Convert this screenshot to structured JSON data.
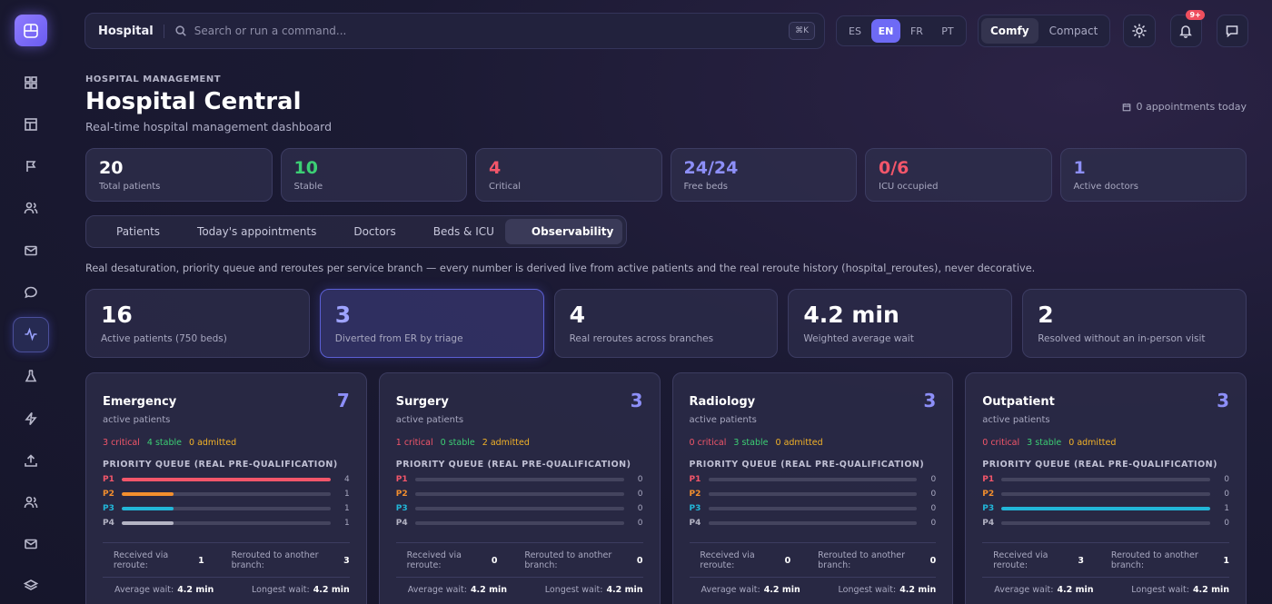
{
  "topbar": {
    "app_name": "Hospital",
    "search_placeholder": "Search or run a command...",
    "shortcut": "⌘K",
    "languages": [
      "ES",
      "EN",
      "FR",
      "PT"
    ],
    "active_language": "EN",
    "density": [
      "Comfy",
      "Compact"
    ],
    "active_density": "Comfy",
    "notification_badge": "9+"
  },
  "header": {
    "eyebrow": "HOSPITAL MANAGEMENT",
    "title": "Hospital Central",
    "subtitle": "Real-time hospital management dashboard",
    "appointments": "0 appointments today"
  },
  "kpis": [
    {
      "value": "20",
      "label": "Total patients",
      "color": "#ffffff"
    },
    {
      "value": "10",
      "label": "Stable",
      "color": "#3ccf74"
    },
    {
      "value": "4",
      "label": "Critical",
      "color": "#f3566a"
    },
    {
      "value": "24/24",
      "label": "Free beds",
      "color": "#8d8ff8"
    },
    {
      "value": "0/6",
      "label": "ICU occupied",
      "color": "#f3566a"
    },
    {
      "value": "1",
      "label": "Active doctors",
      "color": "#8d8ff8"
    }
  ],
  "tabs": [
    {
      "label": "Patients",
      "icon": "users-icon"
    },
    {
      "label": "Today's appointments",
      "icon": "calendar-icon"
    },
    {
      "label": "Doctors",
      "icon": "shield-icon"
    },
    {
      "label": "Beds & ICU",
      "icon": "grid-icon"
    },
    {
      "label": "Observability",
      "icon": "activity-icon",
      "active": true
    }
  ],
  "note": "Real desaturation, priority queue and reroutes per service branch — every number is derived live from active patients and the real reroute history (hospital_reroutes), never decorative.",
  "stats": [
    {
      "value": "16",
      "label": "Active patients (750 beds)"
    },
    {
      "value": "3",
      "label": "Diverted from ER by triage",
      "highlight": true
    },
    {
      "value": "4",
      "label": "Real reroutes across branches"
    },
    {
      "value": "4.2 min",
      "label": "Weighted average wait"
    },
    {
      "value": "2",
      "label": "Resolved without an in-person visit"
    }
  ],
  "labels": {
    "active_patients": "active patients",
    "priority_queue": "PRIORITY QUEUE (REAL PRE-QUALIFICATION)",
    "received": "Received via reroute:",
    "rerouted": "Rerouted to another branch:",
    "avg_wait": "Average wait:",
    "longest_wait": "Longest wait:",
    "critical": "critical",
    "stable": "stable",
    "admitted": "admitted"
  },
  "priority_colors": {
    "P1": "#f3566a",
    "P2": "#f38f2e",
    "P3": "#22b6d8",
    "P4": "#b4b4c4"
  },
  "branches": [
    {
      "name": "Emergency",
      "count": "7",
      "critical": "3",
      "stable": "4",
      "admitted": "0",
      "queue": [
        {
          "p": "P1",
          "n": 4
        },
        {
          "p": "P2",
          "n": 1
        },
        {
          "p": "P3",
          "n": 1
        },
        {
          "p": "P4",
          "n": 1
        }
      ],
      "received": "1",
      "rerouted": "3",
      "avg_wait": "4.2 min",
      "longest_wait": "4.2 min"
    },
    {
      "name": "Surgery",
      "count": "3",
      "critical": "1",
      "stable": "0",
      "admitted": "2",
      "queue": [
        {
          "p": "P1",
          "n": 0
        },
        {
          "p": "P2",
          "n": 0
        },
        {
          "p": "P3",
          "n": 0
        },
        {
          "p": "P4",
          "n": 0
        }
      ],
      "received": "0",
      "rerouted": "0",
      "avg_wait": "4.2 min",
      "longest_wait": "4.2 min"
    },
    {
      "name": "Radiology",
      "count": "3",
      "critical": "0",
      "stable": "3",
      "admitted": "0",
      "queue": [
        {
          "p": "P1",
          "n": 0
        },
        {
          "p": "P2",
          "n": 0
        },
        {
          "p": "P3",
          "n": 0
        },
        {
          "p": "P4",
          "n": 0
        }
      ],
      "received": "0",
      "rerouted": "0",
      "avg_wait": "4.2 min",
      "longest_wait": "4.2 min"
    },
    {
      "name": "Outpatient",
      "count": "3",
      "critical": "0",
      "stable": "3",
      "admitted": "0",
      "queue": [
        {
          "p": "P1",
          "n": 0
        },
        {
          "p": "P2",
          "n": 0
        },
        {
          "p": "P3",
          "n": 1
        },
        {
          "p": "P4",
          "n": 0
        }
      ],
      "received": "3",
      "rerouted": "1",
      "avg_wait": "4.2 min",
      "longest_wait": "4.2 min"
    }
  ]
}
